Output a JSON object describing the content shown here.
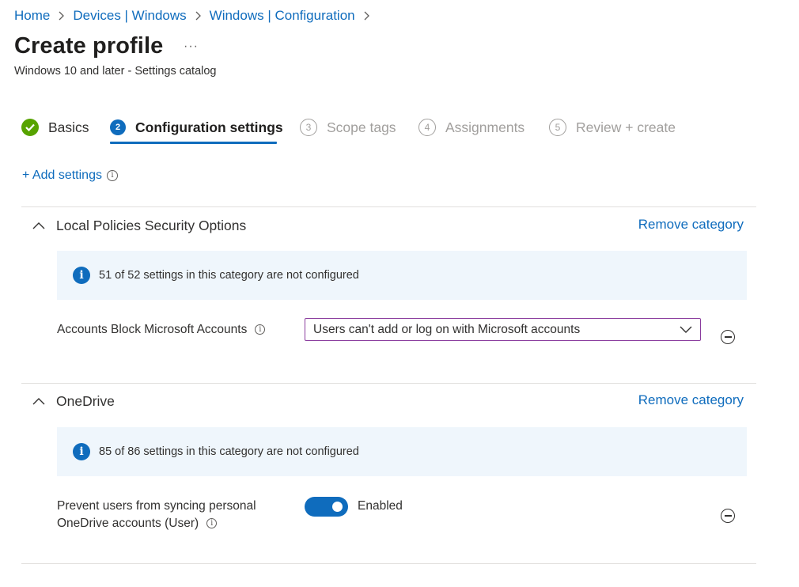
{
  "breadcrumb": [
    "Home",
    "Devices | Windows",
    "Windows | Configuration"
  ],
  "page": {
    "title": "Create profile",
    "more": "···",
    "subtitle": "Windows 10 and later - Settings catalog"
  },
  "steps": [
    {
      "number": "✓",
      "label": "Basics",
      "state": "done"
    },
    {
      "number": "2",
      "label": "Configuration settings",
      "state": "active"
    },
    {
      "number": "3",
      "label": "Scope tags",
      "state": "future"
    },
    {
      "number": "4",
      "label": "Assignments",
      "state": "future"
    },
    {
      "number": "5",
      "label": "Review + create",
      "state": "future"
    }
  ],
  "add_settings": "+ Add settings",
  "categories": [
    {
      "name": "Local Policies Security Options",
      "remove_label": "Remove category",
      "info": "51 of 52 settings in this category are not configured",
      "setting": {
        "label": "Accounts Block Microsoft Accounts",
        "value": "Users can't add or log on with Microsoft accounts"
      }
    },
    {
      "name": "OneDrive",
      "remove_label": "Remove category",
      "info": "85 of 86 settings in this category are not configured",
      "setting": {
        "label_line1": "Prevent users from syncing personal",
        "label_line2": "OneDrive accounts (User)",
        "toggle_state": "Enabled"
      }
    }
  ],
  "colors": {
    "link": "#0f6cbd",
    "success": "#57a300",
    "info_bg": "#eff6fc",
    "dropdown_border": "#8a3c9e"
  },
  "icons": {
    "chevron": "chevron-right-icon",
    "info": "info-icon",
    "collapse": "chevron-up-icon",
    "remove": "remove-circle-icon",
    "check": "checkmark-icon"
  }
}
